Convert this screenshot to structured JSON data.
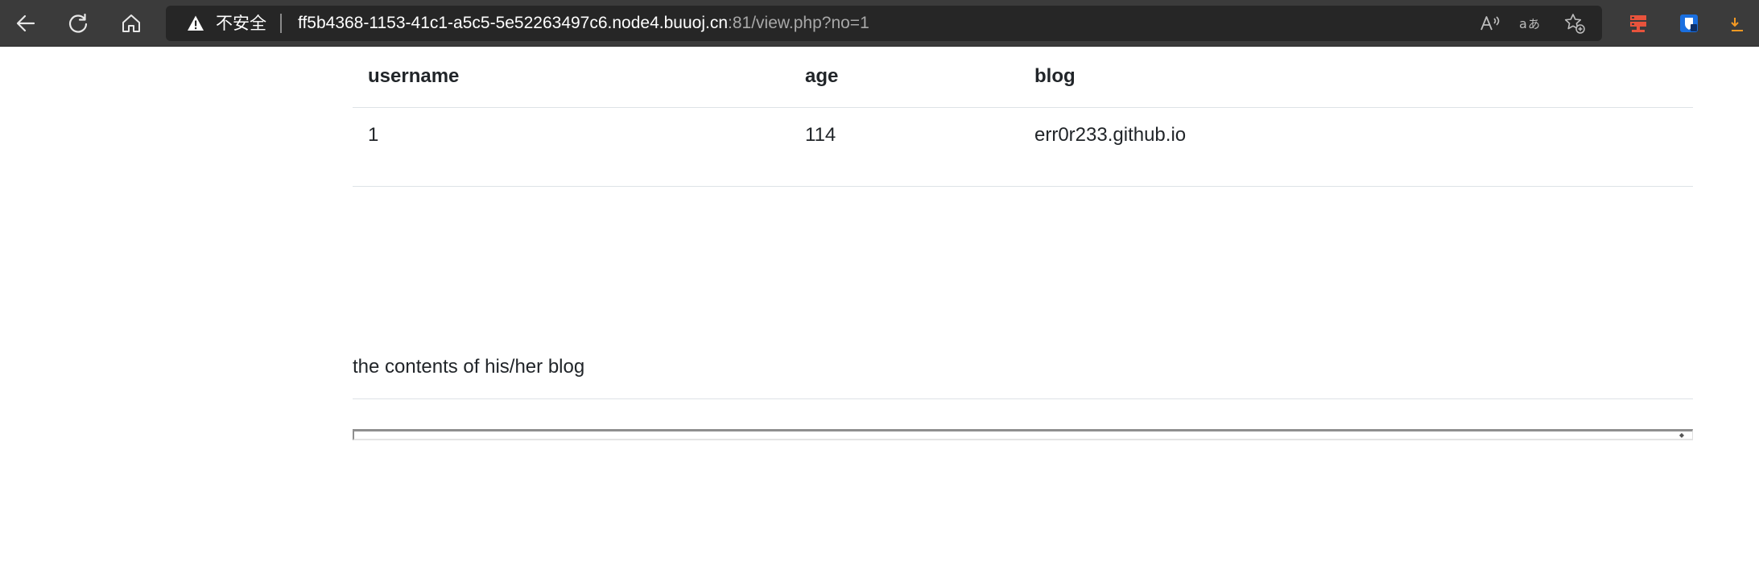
{
  "browser": {
    "security_label": "不安全",
    "url_host": "ff5b4368-1153-41c1-a5c5-5e52263497c6.node4.buuoj.cn",
    "url_path": ":81/view.php?no=1",
    "accent_colors": {
      "toolbar": "#3b3b3b",
      "address_bar": "#262626",
      "extension_red": "#e8533c",
      "extension_blue": "#1a6fe0",
      "extension_orange": "#f59a23"
    }
  },
  "table": {
    "headers": [
      "username",
      "age",
      "blog"
    ],
    "rows": [
      [
        "1",
        "114",
        "err0r233.github.io"
      ]
    ]
  },
  "blog_section": {
    "heading": "the contents of his/her blog"
  }
}
